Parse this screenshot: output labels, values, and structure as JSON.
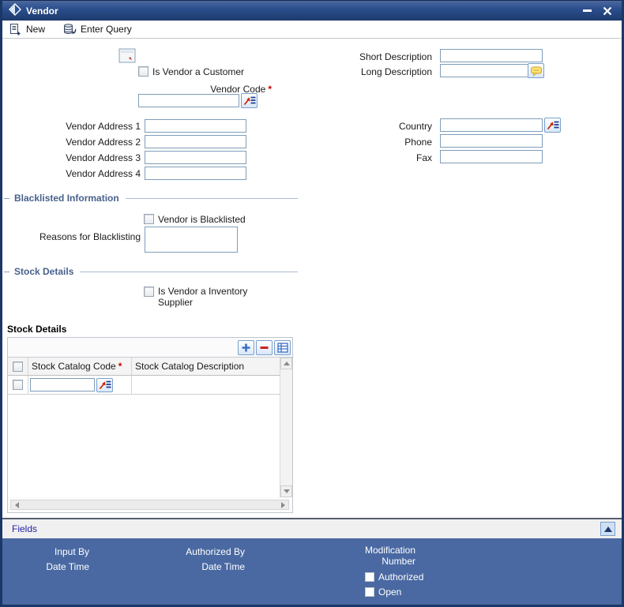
{
  "window": {
    "title": "Vendor"
  },
  "toolbar": {
    "new_label": "New",
    "enter_query_label": "Enter Query"
  },
  "misc": {
    "required_marker": "*"
  },
  "form": {
    "is_vendor_customer_label": "Is Vendor a Customer",
    "vendor_code_label": "Vendor Code",
    "short_description_label": "Short Description",
    "long_description_label": "Long Description",
    "vendor_address1_label": "Vendor Address 1",
    "vendor_address2_label": "Vendor Address 2",
    "vendor_address3_label": "Vendor Address 3",
    "vendor_address4_label": "Vendor Address 4",
    "country_label": "Country",
    "phone_label": "Phone",
    "fax_label": "Fax",
    "values": {
      "vendor_code": "",
      "short_description": "",
      "long_description": "",
      "vendor_address1": "",
      "vendor_address2": "",
      "vendor_address3": "",
      "vendor_address4": "",
      "country": "",
      "phone": "",
      "fax": "",
      "reasons_for_blacklisting": ""
    },
    "checkbox_states": {
      "is_vendor_customer": false,
      "vendor_is_blacklisted": false,
      "is_inventory_supplier": false
    }
  },
  "sections": {
    "blacklisted": {
      "title": "Blacklisted Information",
      "vendor_is_blacklisted_label": "Vendor is Blacklisted",
      "reasons_label": "Reasons for Blacklisting"
    },
    "stock": {
      "title": "Stock Details",
      "inventory_supplier_label": "Is Vendor a Inventory Supplier",
      "grid_title": "Stock Details"
    }
  },
  "grid": {
    "columns": [
      "Stock Catalog Code",
      "Stock Catalog Description"
    ],
    "required_column": "Stock Catalog Code",
    "rows": [
      {
        "stock_catalog_code": "",
        "stock_catalog_description": ""
      }
    ]
  },
  "fields_bar": {
    "link_label": "Fields"
  },
  "footer": {
    "input_by_label": "Input By",
    "input_date_time_label": "Date Time",
    "authorized_by_label": "Authorized By",
    "authorized_date_time_label": "Date Time",
    "modification_number_label": "Modification Number",
    "authorized_checkbox_label": "Authorized",
    "open_checkbox_label": "Open",
    "authorized_checked": false,
    "open_checked": false
  },
  "icons": {
    "titlebar_diamond": "diamond",
    "new": "document-plus",
    "enter_query": "database-refresh",
    "lov": "red-arrow-to-list",
    "text_editor": "speech-bubble",
    "grid_add": "plus",
    "grid_delete": "minus",
    "grid_single_view": "table",
    "minimize": "horizontal-bar",
    "close": "x-cross"
  },
  "colors": {
    "titlebar_top": "#4c689f",
    "titlebar_bottom": "#1d3a6b",
    "window_border": "#1b3768",
    "footer_bg": "#4a69a2",
    "section_title": "#47618c",
    "required_marker": "#cc0000",
    "fields_link": "#2222aa",
    "input_border": "#7f9db9",
    "button_border": "#7aa0cc"
  }
}
